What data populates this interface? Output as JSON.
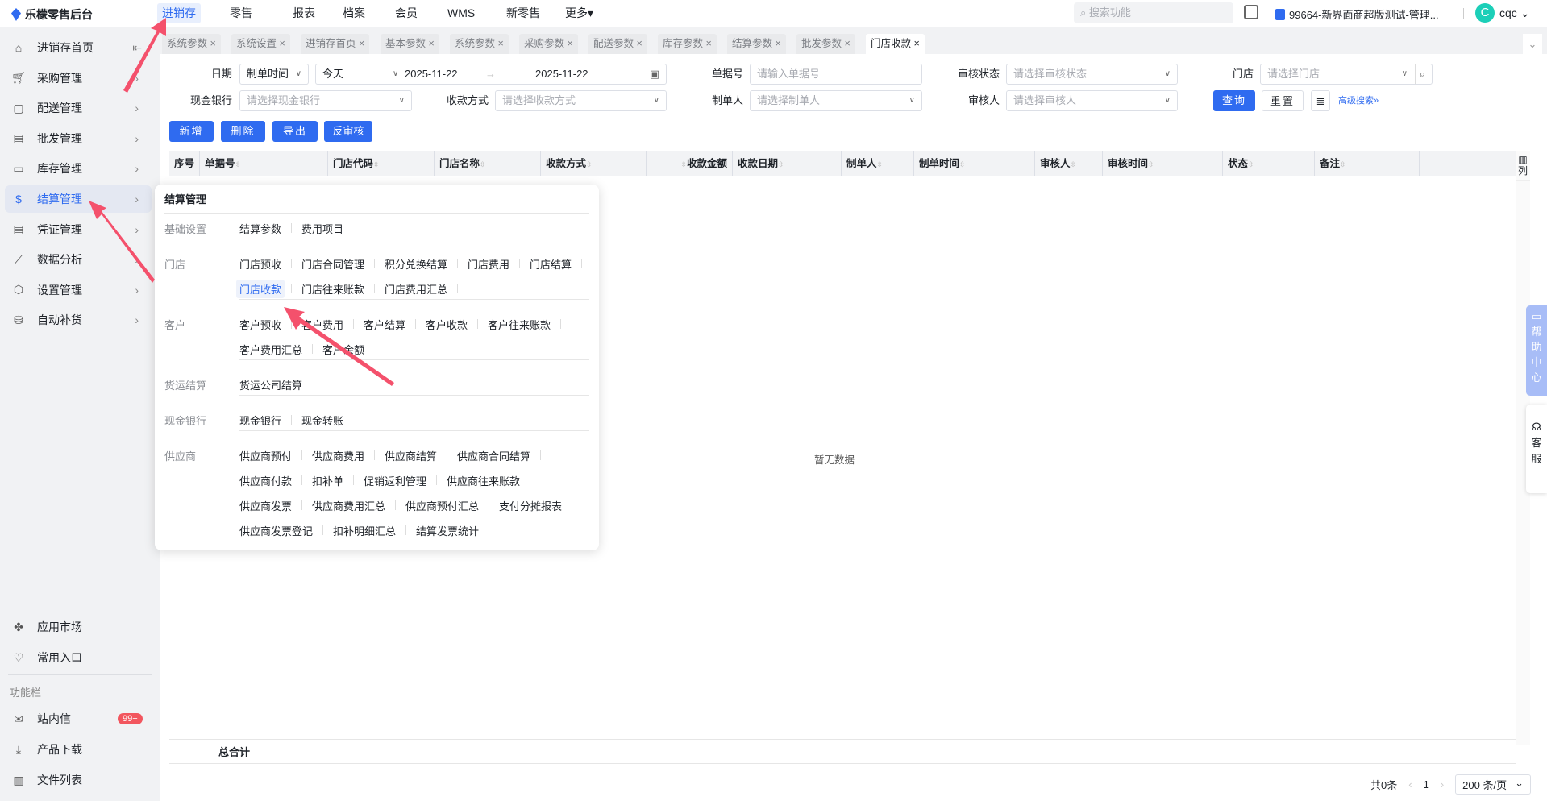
{
  "app": {
    "title": "乐檬零售后台"
  },
  "topnav": [
    {
      "label": "进销存",
      "active": true
    },
    {
      "label": "零售"
    },
    {
      "label": "报表"
    },
    {
      "label": "档案"
    },
    {
      "label": "会员"
    },
    {
      "label": "WMS"
    },
    {
      "label": "新零售"
    },
    {
      "label": "更多▾"
    }
  ],
  "header": {
    "search_placeholder": "搜索功能",
    "tenant": "99664-新界面商超版测试-管理...",
    "avatar_letter": "C",
    "user": "cqc"
  },
  "sidebar": {
    "items": [
      {
        "label": "进销存首页",
        "icon": "home-icon"
      },
      {
        "label": "采购管理",
        "icon": "cart-icon"
      },
      {
        "label": "配送管理",
        "icon": "box-icon"
      },
      {
        "label": "批发管理",
        "icon": "server-icon"
      },
      {
        "label": "库存管理",
        "icon": "inventory-icon"
      },
      {
        "label": "结算管理",
        "icon": "dollar-icon",
        "active": true
      },
      {
        "label": "凭证管理",
        "icon": "document-icon"
      },
      {
        "label": "数据分析",
        "icon": "chart-icon"
      },
      {
        "label": "设置管理",
        "icon": "settings-icon"
      },
      {
        "label": "自动补货",
        "icon": "restock-icon"
      }
    ],
    "bottom": [
      {
        "label": "应用市场",
        "icon": "app-market-icon"
      },
      {
        "label": "常用入口",
        "icon": "heart-icon"
      }
    ],
    "section_label": "功能栏",
    "functions": [
      {
        "label": "站内信",
        "icon": "mail-icon",
        "badge": "99+"
      },
      {
        "label": "产品下载",
        "icon": "download-icon"
      },
      {
        "label": "文件列表",
        "icon": "file-list-icon"
      }
    ]
  },
  "tabs": [
    {
      "label": "系统参数"
    },
    {
      "label": "系统设置"
    },
    {
      "label": "进销存首页"
    },
    {
      "label": "基本参数"
    },
    {
      "label": "系统参数"
    },
    {
      "label": "采购参数"
    },
    {
      "label": "配送参数"
    },
    {
      "label": "库存参数"
    },
    {
      "label": "结算参数"
    },
    {
      "label": "批发参数"
    },
    {
      "label": "门店收款",
      "active": true
    }
  ],
  "filters": {
    "date_label": "日期",
    "date_type": "制单时间",
    "date_preset": "今天",
    "date_start": "2025-11-22",
    "date_end": "2025-11-22",
    "doc_no_label": "单据号",
    "doc_no_placeholder": "请输入单据号",
    "audit_status_label": "审核状态",
    "audit_status_placeholder": "请选择审核状态",
    "store_label": "门店",
    "store_placeholder": "请选择门店",
    "bank_label": "现金银行",
    "bank_placeholder": "请选择现金银行",
    "pay_method_label": "收款方式",
    "pay_method_placeholder": "请选择收款方式",
    "maker_label": "制单人",
    "maker_placeholder": "请选择制单人",
    "auditor_label": "审核人",
    "auditor_placeholder": "请选择审核人",
    "query": "查询",
    "reset": "重置",
    "advanced": "高级搜索»"
  },
  "actions": {
    "add": "新增",
    "delete": "删除",
    "export": "导出",
    "unaudit": "反审核"
  },
  "table": {
    "columns": [
      "序号",
      "单据号",
      "门店代码",
      "门店名称",
      "收款方式",
      "收款金额",
      "收款日期",
      "制单人",
      "制单时间",
      "审核人",
      "审核时间",
      "状态",
      "备注"
    ],
    "column_settings": "列",
    "empty": "暂无数据",
    "total_label": "总合计"
  },
  "pagination": {
    "total": "共0条",
    "page": "1",
    "page_size": "200 条/页"
  },
  "menu": {
    "title": "结算管理",
    "groups": [
      {
        "label": "基础设置",
        "rows": [
          [
            "结算参数",
            "费用项目"
          ]
        ]
      },
      {
        "label": "门店",
        "rows": [
          [
            "门店预收",
            "门店合同管理",
            "积分兑换结算",
            "门店费用",
            "门店结算"
          ],
          [
            "门店收款",
            "门店往来账款",
            "门店费用汇总"
          ]
        ]
      },
      {
        "label": "客户",
        "rows": [
          [
            "客户预收",
            "客户费用",
            "客户结算",
            "客户收款",
            "客户往来账款"
          ],
          [
            "客户费用汇总",
            "客户余额"
          ]
        ]
      },
      {
        "label": "货运结算",
        "rows": [
          [
            "货运公司结算"
          ]
        ]
      },
      {
        "label": "现金银行",
        "rows": [
          [
            "现金银行",
            "现金转账"
          ]
        ]
      },
      {
        "label": "供应商",
        "rows": [
          [
            "供应商预付",
            "供应商费用",
            "供应商结算",
            "供应商合同结算"
          ],
          [
            "供应商付款",
            "扣补单",
            "促销返利管理",
            "供应商往来账款"
          ],
          [
            "供应商发票",
            "供应商费用汇总",
            "供应商预付汇总",
            "支付分摊报表"
          ],
          [
            "供应商发票登记",
            "扣补明细汇总",
            "结算发票统计"
          ]
        ]
      }
    ],
    "active_item": "门店收款"
  },
  "floating": {
    "help": "帮助中心",
    "service": "客服"
  },
  "colors": {
    "accent": "#2f6bf0",
    "badge": "#f2565e",
    "arrow": "#f4516c"
  }
}
